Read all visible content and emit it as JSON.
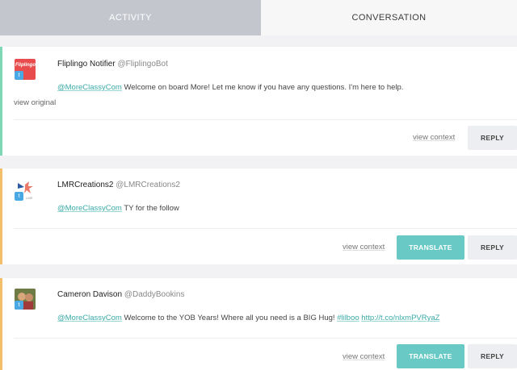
{
  "tabs": {
    "activity": "ACTIVITY",
    "conversation": "CONVERSATION"
  },
  "colors": {
    "accent_teal": "#69c9c4",
    "green_border": "#7fd7b6",
    "orange_border": "#f3bf6a",
    "twitter_blue": "#4aa9e4"
  },
  "cards": [
    {
      "name": "Fliplingo Notifier",
      "handle": "@FliplingoBot",
      "avatar_text": "Fliplingo",
      "mention": "@MoreClassyCom",
      "text": " Welcome on board More! Let me know if you have any questions. I'm here to help.",
      "view_original": "view original",
      "view_context": "view context",
      "reply": "REPLY"
    },
    {
      "name": "LMRCreations2",
      "handle": "@LMRCreations2",
      "mention": "@MoreClassyCom",
      "text": " TY for the follow",
      "view_context": "view context",
      "translate": "TRANSLATE",
      "reply": "REPLY"
    },
    {
      "name": "Cameron Davison",
      "handle": "@DaddyBookins",
      "mention": "@MoreClassyCom",
      "text": " Welcome to the YOB Years! Where all you need is a BIG Hug! ",
      "hashtag": "#lilboo",
      "url": "http://t.co/nlxmPVRyaZ",
      "view_context": "view context",
      "translate": "TRANSLATE",
      "reply": "REPLY"
    }
  ]
}
